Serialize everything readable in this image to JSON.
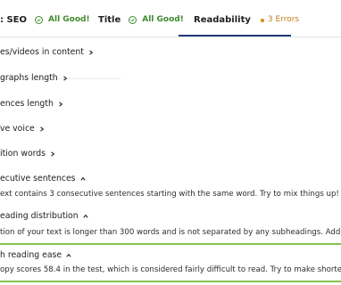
{
  "tabs": [
    {
      "label": ": SEO",
      "status": "All Good!"
    },
    {
      "label": "Title",
      "status": "All Good!"
    },
    {
      "label": "Readability",
      "status": "3 Errors"
    }
  ],
  "items": [
    {
      "label": "es/videos in content"
    },
    {
      "label": "graphs length"
    },
    {
      "label": "ences length"
    },
    {
      "label": "ve voice"
    },
    {
      "label": "ition words"
    },
    {
      "label": "ecutive sentences",
      "description": "ext contains 3 consecutive sentences starting with the same word. Try to mix things up!"
    },
    {
      "label": "eading distribution",
      "description": "tion of your text is longer than 300 words and is not separated by any subheadings. Add subhea"
    },
    {
      "label": "h reading ease",
      "description": "opy scores 58.4 in the test, which is considered fairly difficult to read. Try to make shorter senten"
    }
  ],
  "colors": {
    "good": "#3f8a2f",
    "warn": "#d98b1f",
    "active_tab": "#1e3a78",
    "divider": "#86c24c"
  }
}
